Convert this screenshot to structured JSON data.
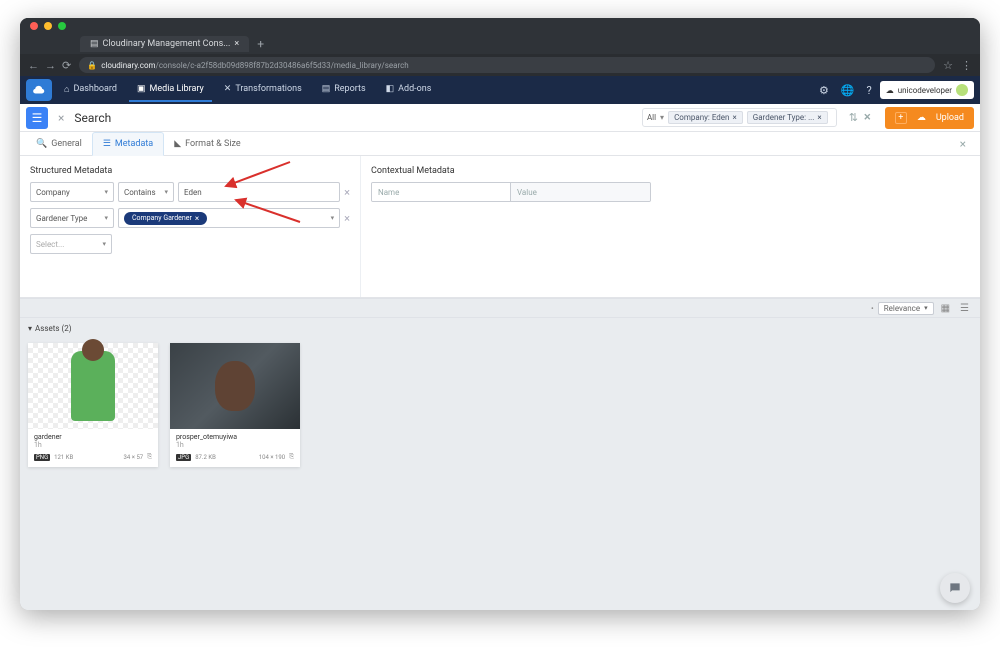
{
  "browser": {
    "tab_title": "Cloudinary Management Cons...",
    "url_domain": "cloudinary.com",
    "url_path": "/console/c-a2f58db09d898f87b2d30486a6f5d33/media_library/search"
  },
  "topnav": {
    "items": [
      {
        "icon": "home",
        "label": "Dashboard"
      },
      {
        "icon": "media",
        "label": "Media Library"
      },
      {
        "icon": "transform",
        "label": "Transformations"
      },
      {
        "icon": "reports",
        "label": "Reports"
      },
      {
        "icon": "addons",
        "label": "Add-ons"
      }
    ],
    "user_label": "unicodeveloper"
  },
  "search": {
    "title": "Search",
    "scope": "All",
    "chips": [
      {
        "label": "Company: Eden"
      },
      {
        "label": "Gardener Type: ..."
      }
    ],
    "upload": "Upload"
  },
  "tabs": {
    "general": "General",
    "metadata": "Metadata",
    "format": "Format & Size"
  },
  "structured": {
    "title": "Structured Metadata",
    "rows": [
      {
        "field": "Company",
        "op": "Contains",
        "value": "Eden"
      },
      {
        "field": "Gardener Type",
        "op": "",
        "tag": "Company Gardener"
      }
    ],
    "add_placeholder": "Select..."
  },
  "contextual": {
    "title": "Contextual Metadata",
    "name_placeholder": "Name",
    "value_placeholder": "Value"
  },
  "assets": {
    "sort_label": "Relevance",
    "count_label": "Assets (2)",
    "cards": [
      {
        "name": "gardener",
        "sub": "1h",
        "format": "PNG",
        "size": "121 KB",
        "dims": "34 × 57"
      },
      {
        "name": "prosper_otemuyiwa",
        "sub": "1h",
        "format": "JPG",
        "size": "87.2 KB",
        "dims": "104 × 190"
      }
    ]
  },
  "colors": {
    "red": "#ff5f56",
    "yellow": "#ffbd2e",
    "green": "#27c93f"
  }
}
